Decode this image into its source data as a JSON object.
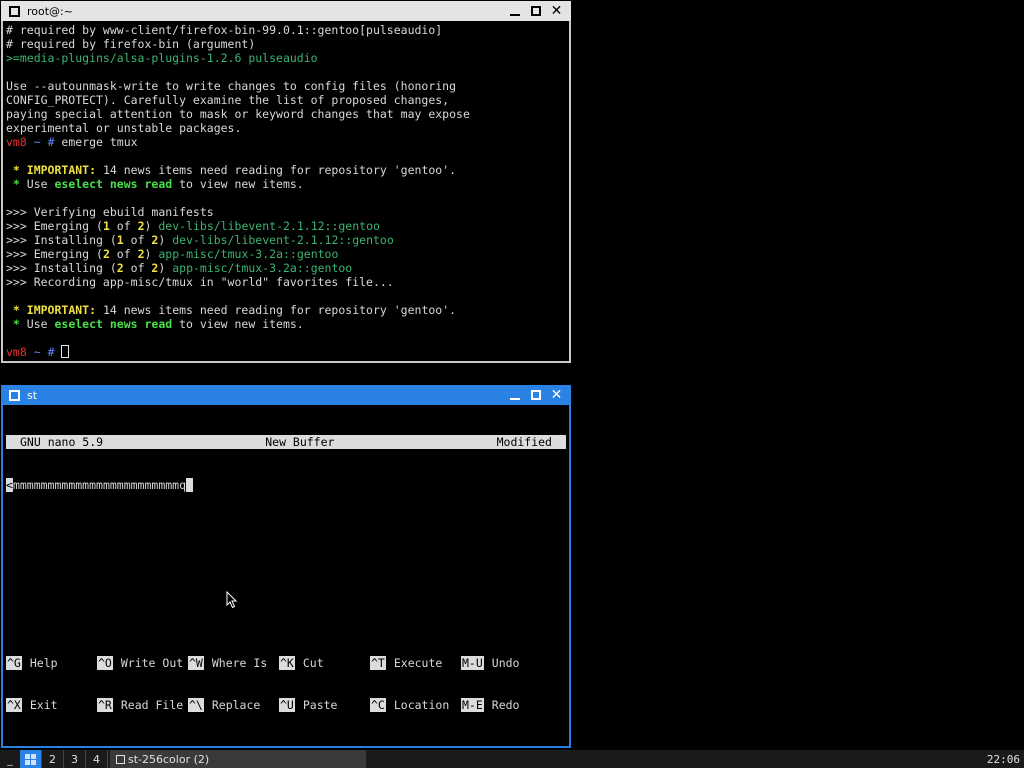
{
  "top_window": {
    "title": "root@:~",
    "lines": [
      [
        {
          "t": "# required by www-client/firefox-bin-99.0.1::gentoo[pulseaudio]",
          "c": ""
        }
      ],
      [
        {
          "t": "# required by firefox-bin (argument)",
          "c": ""
        }
      ],
      [
        {
          "t": ">=media-plugins/alsa-plugins-1.2.6 pulseaudio",
          "c": "green"
        }
      ],
      [
        {
          "t": "",
          "c": ""
        }
      ],
      [
        {
          "t": "Use --autounmask-write to write changes to config files (honoring",
          "c": ""
        }
      ],
      [
        {
          "t": "CONFIG_PROTECT). Carefully examine the list of proposed changes,",
          "c": ""
        }
      ],
      [
        {
          "t": "paying special attention to mask or keyword changes that may expose",
          "c": ""
        }
      ],
      [
        {
          "t": "experimental or unstable packages.",
          "c": ""
        }
      ],
      [
        {
          "t": "vm8",
          "c": "red"
        },
        {
          "t": " ~ ",
          "c": "blue"
        },
        {
          "t": "# ",
          "c": "blue"
        },
        {
          "t": "emerge tmux",
          "c": ""
        }
      ],
      [
        {
          "t": "",
          "c": ""
        }
      ],
      [
        {
          "t": " * ",
          "c": "yellow"
        },
        {
          "t": "IMPORTANT:",
          "c": "yellow"
        },
        {
          "t": " 14 news items need reading for repository 'gentoo'.",
          "c": ""
        }
      ],
      [
        {
          "t": " * ",
          "c": "bgreen"
        },
        {
          "t": "Use ",
          "c": ""
        },
        {
          "t": "eselect news read",
          "c": "bgreen"
        },
        {
          "t": " to view new items.",
          "c": ""
        }
      ],
      [
        {
          "t": "",
          "c": ""
        }
      ],
      [
        {
          "t": ">>> Verifying ebuild manifests",
          "c": ""
        }
      ],
      [
        {
          "t": ">>> Emerging (",
          "c": ""
        },
        {
          "t": "1",
          "c": "yellow"
        },
        {
          "t": " of ",
          "c": ""
        },
        {
          "t": "2",
          "c": "yellow"
        },
        {
          "t": ") ",
          "c": ""
        },
        {
          "t": "dev-libs/libevent-2.1.12::gentoo",
          "c": "green"
        }
      ],
      [
        {
          "t": ">>> Installing (",
          "c": ""
        },
        {
          "t": "1",
          "c": "yellow"
        },
        {
          "t": " of ",
          "c": ""
        },
        {
          "t": "2",
          "c": "yellow"
        },
        {
          "t": ") ",
          "c": ""
        },
        {
          "t": "dev-libs/libevent-2.1.12::gentoo",
          "c": "green"
        }
      ],
      [
        {
          "t": ">>> Emerging (",
          "c": ""
        },
        {
          "t": "2",
          "c": "yellow"
        },
        {
          "t": " of ",
          "c": ""
        },
        {
          "t": "2",
          "c": "yellow"
        },
        {
          "t": ") ",
          "c": ""
        },
        {
          "t": "app-misc/tmux-3.2a::gentoo",
          "c": "green"
        }
      ],
      [
        {
          "t": ">>> Installing (",
          "c": ""
        },
        {
          "t": "2",
          "c": "yellow"
        },
        {
          "t": " of ",
          "c": ""
        },
        {
          "t": "2",
          "c": "yellow"
        },
        {
          "t": ") ",
          "c": ""
        },
        {
          "t": "app-misc/tmux-3.2a::gentoo",
          "c": "green"
        }
      ],
      [
        {
          "t": ">>> Recording app-misc/tmux in \"world\" favorites file...",
          "c": ""
        }
      ],
      [
        {
          "t": "",
          "c": ""
        }
      ],
      [
        {
          "t": " * ",
          "c": "yellow"
        },
        {
          "t": "IMPORTANT:",
          "c": "yellow"
        },
        {
          "t": " 14 news items need reading for repository 'gentoo'.",
          "c": ""
        }
      ],
      [
        {
          "t": " * ",
          "c": "bgreen"
        },
        {
          "t": "Use ",
          "c": ""
        },
        {
          "t": "eselect news read",
          "c": "bgreen"
        },
        {
          "t": " to view new items.",
          "c": ""
        }
      ],
      [
        {
          "t": "",
          "c": ""
        }
      ]
    ],
    "prompt": {
      "host": "vm8",
      "dir": " ~ ",
      "sym": "# "
    }
  },
  "bottom_window": {
    "title": "st",
    "nano": {
      "version": "GNU nano 5.9",
      "buffer": "New Buffer",
      "status": "Modified",
      "first_char": "<",
      "content": "mmmmmmmmmmmmmmmmmmmmmmmmq",
      "shortcuts_row1": [
        {
          "key": "^G",
          "label": "Help"
        },
        {
          "key": "^O",
          "label": "Write Out"
        },
        {
          "key": "^W",
          "label": "Where Is"
        },
        {
          "key": "^K",
          "label": "Cut"
        },
        {
          "key": "^T",
          "label": "Execute"
        },
        {
          "key": "M-U",
          "label": "Undo"
        }
      ],
      "shortcuts_row2": [
        {
          "key": "^X",
          "label": "Exit"
        },
        {
          "key": "^R",
          "label": "Read File"
        },
        {
          "key": "^\\",
          "label": "Replace"
        },
        {
          "key": "^U",
          "label": "Paste"
        },
        {
          "key": "^C",
          "label": "Location"
        },
        {
          "key": "M-E",
          "label": "Redo"
        }
      ]
    }
  },
  "taskbar": {
    "dash": "_",
    "workspaces": [
      "2",
      "3",
      "4"
    ],
    "task_label": "st-256color (2)",
    "clock": "22:06"
  }
}
